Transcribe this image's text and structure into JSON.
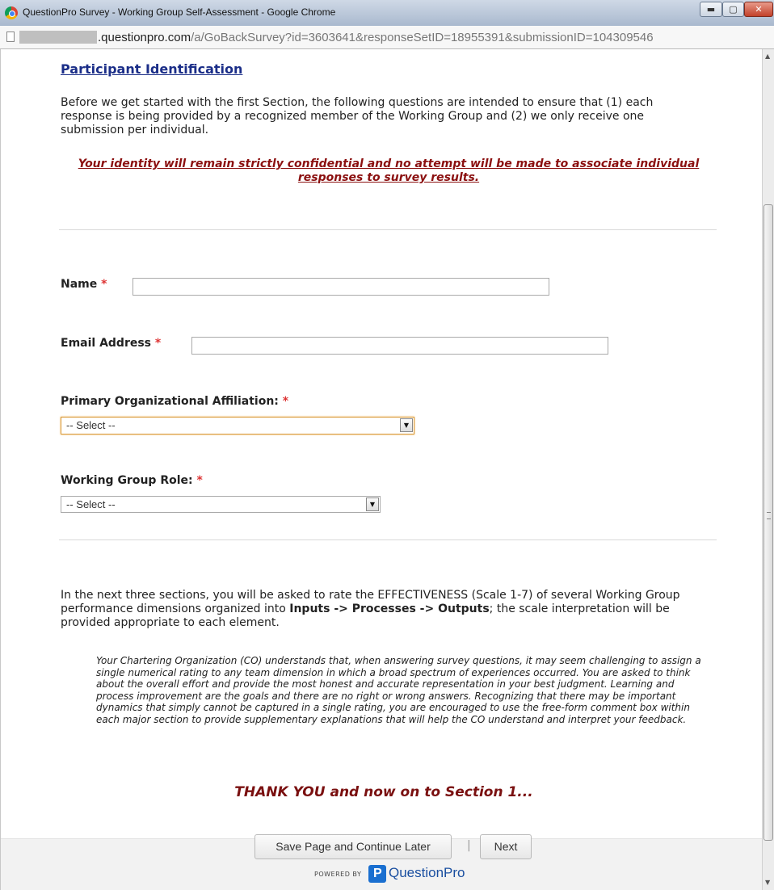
{
  "window": {
    "title": "QuestionPro Survey - Working Group Self-Assessment - Google Chrome",
    "controls": {
      "minimize": "▬",
      "maximize": "▢",
      "close": "✕"
    }
  },
  "address_bar": {
    "url_visible": ".questionpro.com/a/GoBackSurvey?id=3603641&responseSetID=18955391&submissionID=104309546",
    "url_domain": ".questionpro.com",
    "url_path": "/a/GoBackSurvey?id=3603641&responseSetID=18955391&submissionID=104309546"
  },
  "survey": {
    "section_title": "Participant Identification",
    "intro": "Before we get started with the first Section, the following questions are intended to ensure that (1) each response is being provided by a recognized member of the Working Group and (2) we only receive one submission per individual.",
    "confidential_notice": "Your identity will remain strictly confidential and no attempt will be made to associate individual responses to survey results.",
    "required_marker": "*",
    "fields": {
      "name": {
        "label": "Name",
        "value": ""
      },
      "email": {
        "label": "Email Address",
        "value": ""
      },
      "org_affiliation": {
        "label": "Primary Organizational Affiliation:",
        "selected": "-- Select --"
      },
      "working_group_role": {
        "label": "Working Group Role:",
        "selected": "-- Select --"
      }
    },
    "next_sections_intro": {
      "before": "In the next three sections, you will be asked to rate the EFFECTIVENESS (Scale 1-7) of several Working Group performance dimensions organized into ",
      "bold": "Inputs -> Processes -> Outputs",
      "after": "; the scale interpretation will be provided appropriate to each element."
    },
    "co_note": "Your Chartering Organization (CO) understands that, when answering survey questions, it may seem challenging to assign a single numerical rating to any team dimension in which a broad spectrum of experiences occurred. You are asked to think about the overall effort and provide the most honest and accurate representation in your best judgment. Learning and process improvement are the goals and there are no right or wrong answers. Recognizing that there may be important dynamics that simply cannot be captured in a single rating, you are encouraged to use the free-form comment box within each major section to provide supplementary explanations that will help the CO understand and interpret your feedback.",
    "thank_you": "THANK YOU and now on to Section 1..."
  },
  "footer": {
    "save_label": "Save Page and Continue Later",
    "separator": "|",
    "next_label": "Next",
    "powered_by": "POWERED BY",
    "brand": "QuestionPro"
  },
  "icons": {
    "browser": "chrome-icon",
    "page": "page-icon",
    "dropdown": "chevron-down-icon"
  }
}
